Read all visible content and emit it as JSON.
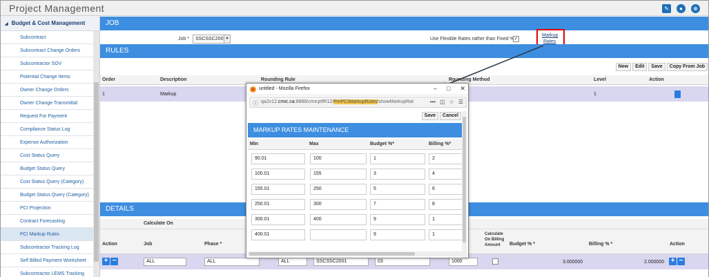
{
  "app": {
    "title": "Project Management"
  },
  "sidebar": {
    "section": "Budget & Cost Management",
    "items": [
      {
        "label": "Subcontract"
      },
      {
        "label": "Subcontract Change Orders"
      },
      {
        "label": "Subcontractor SOV"
      },
      {
        "label": "Potential Change Items"
      },
      {
        "label": "Owner Change Orders"
      },
      {
        "label": "Owner Change Transmittal"
      },
      {
        "label": "Request For Payment"
      },
      {
        "label": "Compliance Status Log"
      },
      {
        "label": "Expense Authorization"
      },
      {
        "label": "Cost Status Query"
      },
      {
        "label": "Budget Status Query"
      },
      {
        "label": "Cost Status Query (Category)"
      },
      {
        "label": "Budget Status Query (Category)"
      },
      {
        "label": "PCI Projection"
      },
      {
        "label": "Contract Forecasting"
      },
      {
        "label": "PCI Markup Rules"
      },
      {
        "label": "Subcontractor Tracking Log"
      },
      {
        "label": "Self Billed Payment Worksheet"
      },
      {
        "label": "Subcontractor LEMS Tracking Log"
      }
    ]
  },
  "job_section": {
    "title": "JOB",
    "job_label": "Job *",
    "job_value": "SSCSSC2001",
    "flex_label": "Use Flexible Rates rather than Fixed %",
    "flex_checked": "✓",
    "markup_link_1": "Markup",
    "markup_link_2": "Rates"
  },
  "rules": {
    "title": "RULES",
    "toolbar": {
      "new": "New",
      "edit": "Edit",
      "save": "Save",
      "copy": "Copy From Job"
    },
    "columns": {
      "order": "Order",
      "description": "Description",
      "rounding_rule": "Rounding Rule",
      "rounding_method": "Rounding Method",
      "level": "Level",
      "action": "Action"
    },
    "row": {
      "order": "1",
      "description": "Markup",
      "level": "1"
    }
  },
  "details": {
    "title": "DETAILS",
    "calculate_on": "Calculate On",
    "columns": {
      "action": "Action",
      "job": "Job",
      "phase": "Phase *",
      "calc_billing_1": "Calculate",
      "calc_billing_2": "On Billing",
      "calc_billing_3": "Amount",
      "budget_pct": "Budget % *",
      "billing_pct": "Billing % *",
      "action2": "Action"
    },
    "row": {
      "job": "ALL",
      "phase": "ALL",
      "cat": "ALL",
      "job2": "SSCSSC2001",
      "phase2": "03",
      "code": "1000",
      "budget": "3.000000",
      "billing": "2.000000"
    }
  },
  "popup": {
    "window_title": "untitled - Mozilla Firefox",
    "url_host": "qa2v12.",
    "url_domain": "cmic.ca",
    "url_port_path": ":8888/cmicptfR12/",
    "url_highlight": "PmPCIMarkupRules",
    "url_rest": "/showMarkupRat",
    "save": "Save",
    "cancel": "Cancel",
    "band_title": "MARKUP RATES MAINTENANCE",
    "columns": {
      "min": "Min",
      "max": "Max",
      "budget": "Budget %*",
      "billing": "Billing %*"
    },
    "rows": [
      {
        "min": "90.01",
        "max": "100",
        "budget": "1",
        "billing": "2"
      },
      {
        "min": "100.01",
        "max": "155",
        "budget": "3",
        "billing": "4"
      },
      {
        "min": "155.01",
        "max": "250",
        "budget": "5",
        "billing": "6"
      },
      {
        "min": "250.01",
        "max": "300",
        "budget": "7",
        "billing": "8"
      },
      {
        "min": "300.01",
        "max": "400",
        "budget": "9",
        "billing": "1"
      },
      {
        "min": "400.01",
        "max": "",
        "budget": "9",
        "billing": "1"
      }
    ]
  },
  "colors": {
    "band": "#3d8ee0",
    "selected_row": "#d9d6f0",
    "highlight_box": "#e00000",
    "url_highlight": "#f2c544"
  }
}
